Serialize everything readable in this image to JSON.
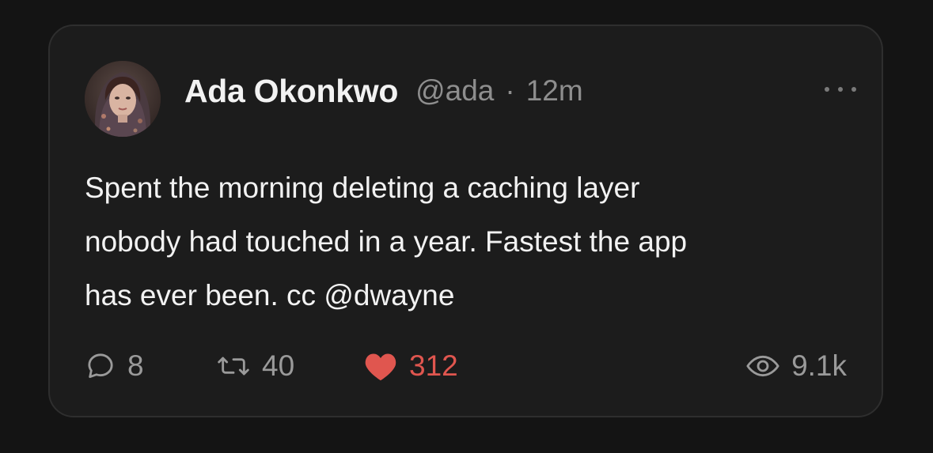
{
  "post": {
    "author_name": "Ada Okonkwo",
    "handle": "@ada",
    "separator": "·",
    "time": "12m",
    "body_lines": [
      "Spent the morning deleting a caching layer",
      "nobody had touched in a year. Fastest the app",
      "has ever been. cc "
    ],
    "mention": "@dwayne",
    "more_icon": "ellipsis-icon"
  },
  "actions": {
    "replies": "8",
    "reposts": "40",
    "likes": "312",
    "views": "9.1k"
  },
  "colors": {
    "background": "#141414",
    "card": "#1c1c1c",
    "border": "#2e2e2e",
    "text": "#f2f2f2",
    "muted": "#9a9a9a",
    "like": "#e0564f"
  }
}
